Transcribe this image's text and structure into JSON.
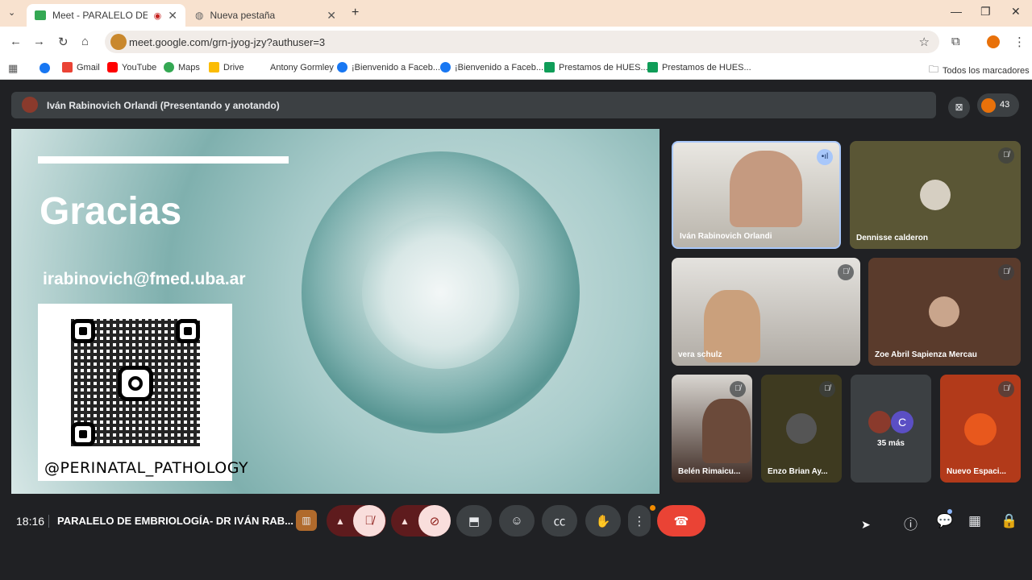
{
  "browser": {
    "tabs": [
      {
        "title": "Meet - PARALELO DE EMBRIO",
        "active": true
      },
      {
        "title": "Nueva pestaña",
        "active": false
      }
    ],
    "new_tab_label": "+",
    "url": "meet.google.com/grn-jyog-jzy?authuser=3",
    "bookmarks": [
      {
        "label": "Gmail",
        "color": "#ea4335"
      },
      {
        "label": "YouTube",
        "color": "#ff0000"
      },
      {
        "label": "Maps",
        "color": "#34a853"
      },
      {
        "label": "Drive",
        "color": "#fbbc04"
      },
      {
        "label": "Antony Gormley",
        "color": "#cccccc"
      },
      {
        "label": "¡Bienvenido a Faceb...",
        "color": "#1877f2"
      },
      {
        "label": "¡Bienvenido a Faceb...",
        "color": "#1877f2"
      },
      {
        "label": "Prestamos de HUES...",
        "color": "#0f9d58"
      },
      {
        "label": "Prestamos de HUES...",
        "color": "#0f9d58"
      }
    ],
    "all_bookmarks_label": "Todos los marcadores"
  },
  "meet": {
    "presenter_banner": "Iván Rabinovich Orlandi (Presentando y anotando)",
    "participant_count": "43",
    "slide": {
      "title": "Gracias",
      "email": "irabinovich@fmed.uba.ar",
      "qr_caption": "@PERINATAL_PATHOLOGY"
    },
    "participants": [
      {
        "name": "Iván Rabinovich Orlandi",
        "muted": false,
        "speaking": true
      },
      {
        "name": "Dennisse calderon",
        "muted": true
      },
      {
        "name": "vera schulz",
        "muted": true
      },
      {
        "name": "Zoe Abril Sapienza Mercau",
        "muted": true
      },
      {
        "name": "Belén Rimaicu...",
        "muted": true
      },
      {
        "name": "Enzo Brian Ay...",
        "muted": true
      },
      {
        "name": "Nuevo Espaci...",
        "muted": true
      }
    ],
    "more_label": "35 más",
    "more_avatar_letter": "C",
    "time": "18:16",
    "meeting_title": "PARALELO DE EMBRIOLOGÍA- DR IVÁN RAB..."
  }
}
